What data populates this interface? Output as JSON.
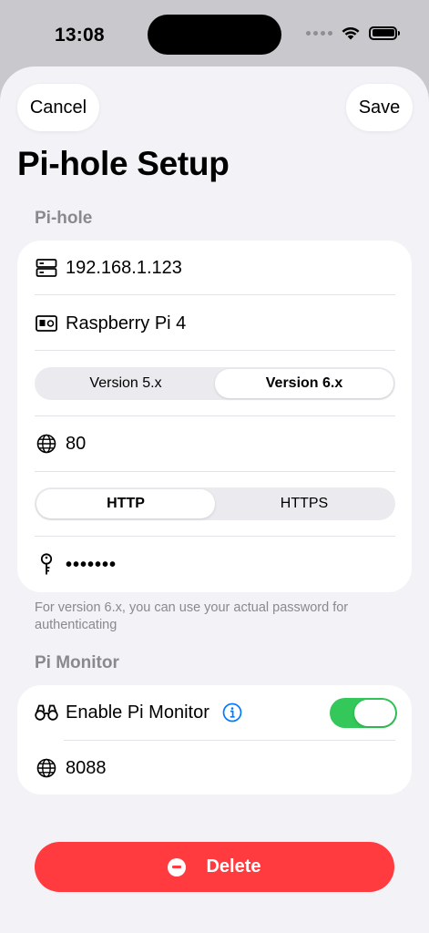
{
  "status_bar": {
    "time": "13:08"
  },
  "nav": {
    "cancel_label": "Cancel",
    "save_label": "Save"
  },
  "title": "Pi-hole Setup",
  "pihole_section": {
    "header": "Pi-hole",
    "address": "192.168.1.123",
    "name": "Raspberry Pi 4",
    "version_options": [
      "Version 5.x",
      "Version 6.x"
    ],
    "version_selected": "Version 6.x",
    "port": "80",
    "protocol_options": [
      "HTTP",
      "HTTPS"
    ],
    "protocol_selected": "HTTP",
    "password_masked": "•••••••",
    "footer_note": "For version 6.x, you can use your actual password for authenticating"
  },
  "monitor_section": {
    "header": "Pi Monitor",
    "enable_label": "Enable Pi Monitor",
    "enabled": true,
    "port": "8088"
  },
  "delete_label": "Delete",
  "colors": {
    "accent_blue": "#007aff",
    "toggle_green": "#34c759",
    "delete_red": "#ff3b3f"
  },
  "icons": [
    "server-icon",
    "id-card-icon",
    "globe-icon",
    "key-icon",
    "binoculars-icon",
    "info-icon",
    "minus-circle-icon",
    "wifi-icon",
    "battery-icon"
  ]
}
